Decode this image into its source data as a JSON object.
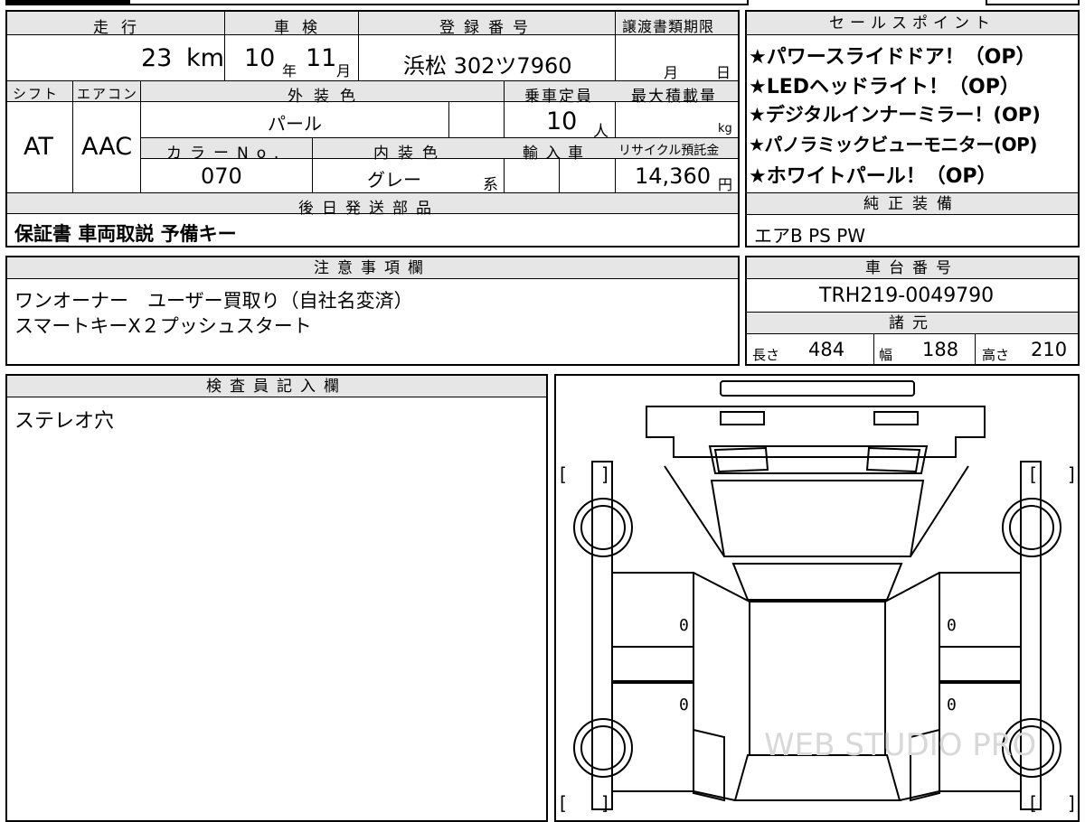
{
  "basic": {
    "mileage_label": "走行",
    "mileage_value": "23",
    "mileage_unit": "km",
    "inspection_label": "車検",
    "inspection_year": "10",
    "inspection_year_unit": "年",
    "inspection_month": "11",
    "inspection_month_unit": "月",
    "registration_label": "登録番号",
    "registration_value": "浜松 302ツ7960",
    "transfer_deadline_label": "譲渡書類期限",
    "transfer_month_unit": "月",
    "transfer_day_unit": "日"
  },
  "spec": {
    "shift_label": "シフト",
    "shift_value": "AT",
    "ac_label": "エアコン",
    "ac_value": "AAC",
    "exterior_color_label": "外装色",
    "exterior_color_value": "パール",
    "capacity_label": "乗車定員",
    "capacity_value": "10",
    "capacity_unit": "人",
    "max_load_label": "最大積載量",
    "max_load_unit": "kg",
    "color_no_label": "カラーNo.",
    "color_no_value": "070",
    "interior_color_label": "内装色",
    "interior_color_value": "グレー",
    "interior_color_suffix": "系",
    "import_label": "輸入車",
    "recycle_label": "リサイクル預託金",
    "recycle_value": "14,360",
    "recycle_unit": "円"
  },
  "later_parts": {
    "label": "後日発送部品",
    "value": "保証書 車両取説 予備キー"
  },
  "sales_points": {
    "label": "セールスポイント",
    "items": [
      "★パワースライドドア！（OP）",
      "★LEDヘッドライト！（OP）",
      "★デジタルインナーミラー！(OP)",
      "★パノラミックビューモニター(OP)",
      "★ホワイトパール！（OP）"
    ]
  },
  "genuine_equipment": {
    "label": "純正装備",
    "value": "エアB PS PW"
  },
  "notes": {
    "label": "注意事項欄",
    "line1": "ワンオーナー　ユーザー買取り（自社名変済）",
    "line2": "スマートキーX２プッシュスタート"
  },
  "chassis": {
    "label": "車台番号",
    "value": "TRH219-0049790"
  },
  "dimensions": {
    "label": "諸元",
    "length_label": "長さ",
    "length_value": "484",
    "width_label": "幅",
    "width_value": "188",
    "height_label": "高さ",
    "height_value": "210"
  },
  "inspector": {
    "label": "検査員記入欄",
    "value": "ステレオ穴"
  },
  "diagram": {
    "marks": [
      "0",
      "0",
      "0",
      "0"
    ],
    "bracket_open": "[",
    "bracket_close": "]",
    "watermark": "WEB STUDIO PRO"
  }
}
